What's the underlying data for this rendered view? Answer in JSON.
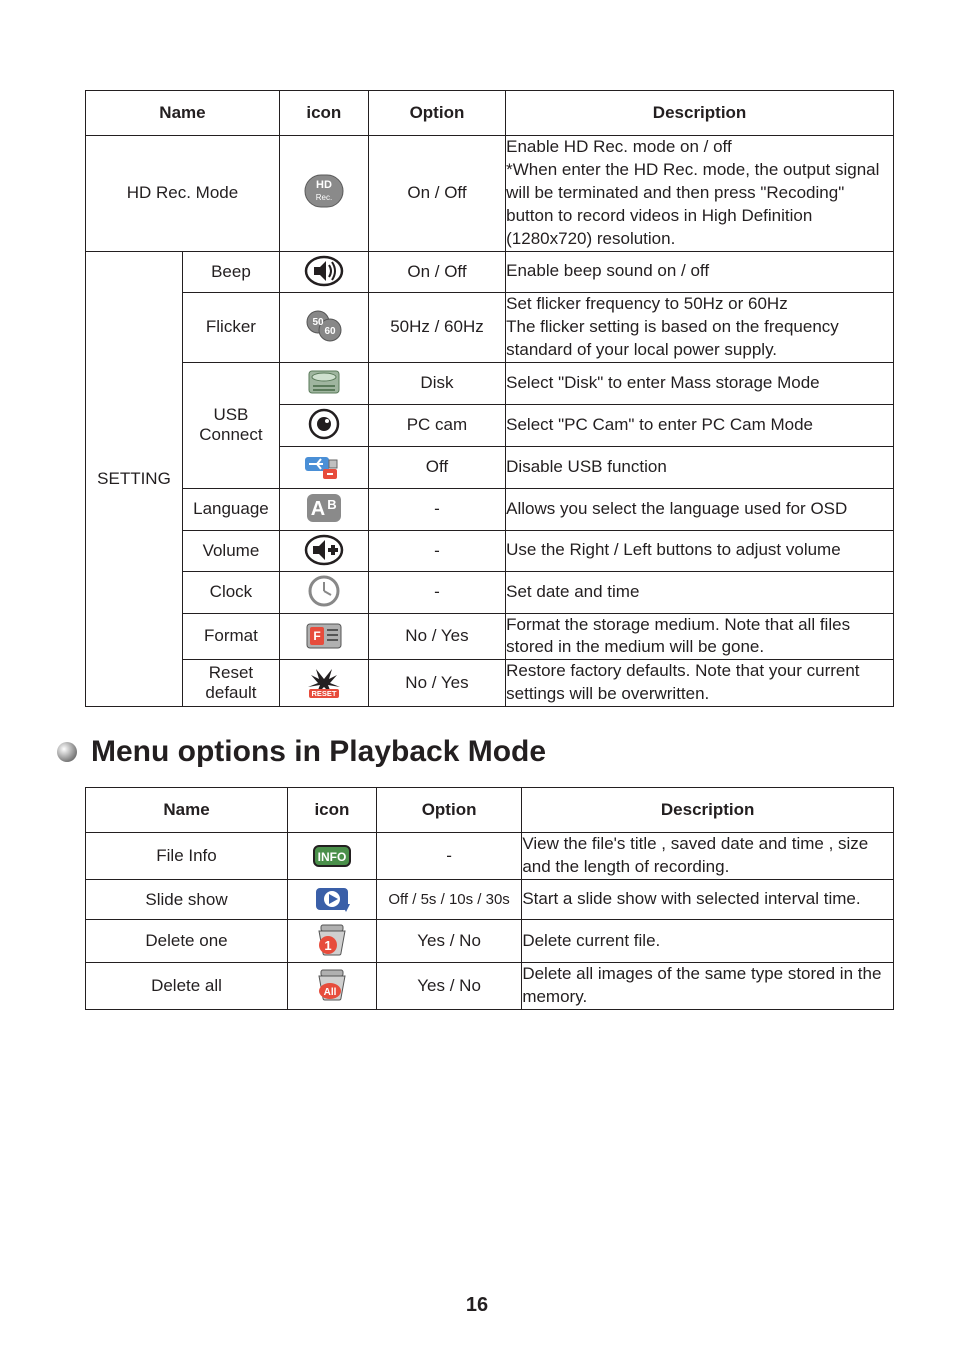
{
  "tables": {
    "settings": {
      "headers": {
        "name": "Name",
        "icon": "icon",
        "option": "Option",
        "description": "Description"
      },
      "rows": [
        {
          "name": "HD Rec. Mode",
          "icon": "hd-rec-icon",
          "option": "On / Off",
          "description": "Enable HD Rec. mode on / off\n*When enter the HD Rec. mode, the output signal will be terminated and then press \"Recoding\" button to record videos in High Definition (1280x720) resolution."
        }
      ],
      "group": {
        "group_name": "SETTING",
        "rows": [
          {
            "sub": "Beep",
            "icon": "beep-icon",
            "option": "On / Off",
            "description": "Enable beep sound on / off"
          },
          {
            "sub": "Flicker",
            "icon": "flicker-icon",
            "option": "50Hz / 60Hz",
            "description": "Set flicker frequency to 50Hz or 60Hz\nThe flicker setting is based on the frequency standard of your local power supply."
          },
          {
            "sub": "USB Connect",
            "usb_rows": [
              {
                "icon": "disk-icon",
                "option": "Disk",
                "description": "Select \"Disk\" to enter Mass storage Mode"
              },
              {
                "icon": "pc-cam-icon",
                "option": "PC cam",
                "description": "Select \"PC Cam\" to enter PC Cam Mode"
              },
              {
                "icon": "usb-off-icon",
                "option": "Off",
                "description": "Disable USB function"
              }
            ]
          },
          {
            "sub": "Language",
            "icon": "language-icon",
            "option": "-",
            "description": "Allows you select the language used for OSD"
          },
          {
            "sub": "Volume",
            "icon": "volume-icon",
            "option": "-",
            "description": "Use the Right / Left buttons to adjust volume"
          },
          {
            "sub": "Clock",
            "icon": "clock-icon",
            "option": "-",
            "description": "Set date and time"
          },
          {
            "sub": "Format",
            "icon": "format-icon",
            "option": "No / Yes",
            "description": "Format the storage medium. Note that all files stored in the medium will be gone."
          },
          {
            "sub": "Reset default",
            "icon": "reset-icon",
            "option": "No / Yes",
            "description": "Restore factory defaults. Note that your current settings will be overwritten."
          }
        ]
      }
    },
    "playback": {
      "heading": "Menu options in Playback Mode",
      "headers": {
        "name": "Name",
        "icon": "icon",
        "option": "Option",
        "description": "Description"
      },
      "rows": [
        {
          "name": "File Info",
          "icon": "info-icon",
          "option": "-",
          "description": "View the file's title , saved date and time , size and the length of recording."
        },
        {
          "name": "Slide show",
          "icon": "slideshow-icon",
          "option": "Off / 5s / 10s / 30s",
          "description": "Start a slide show with selected interval time."
        },
        {
          "name": "Delete one",
          "icon": "delete-one-icon",
          "option": "Yes / No",
          "description": "Delete current file."
        },
        {
          "name": "Delete all",
          "icon": "delete-all-icon",
          "option": "Yes / No",
          "description": "Delete all images of the same type stored in the memory."
        }
      ]
    }
  },
  "page_number": "16"
}
